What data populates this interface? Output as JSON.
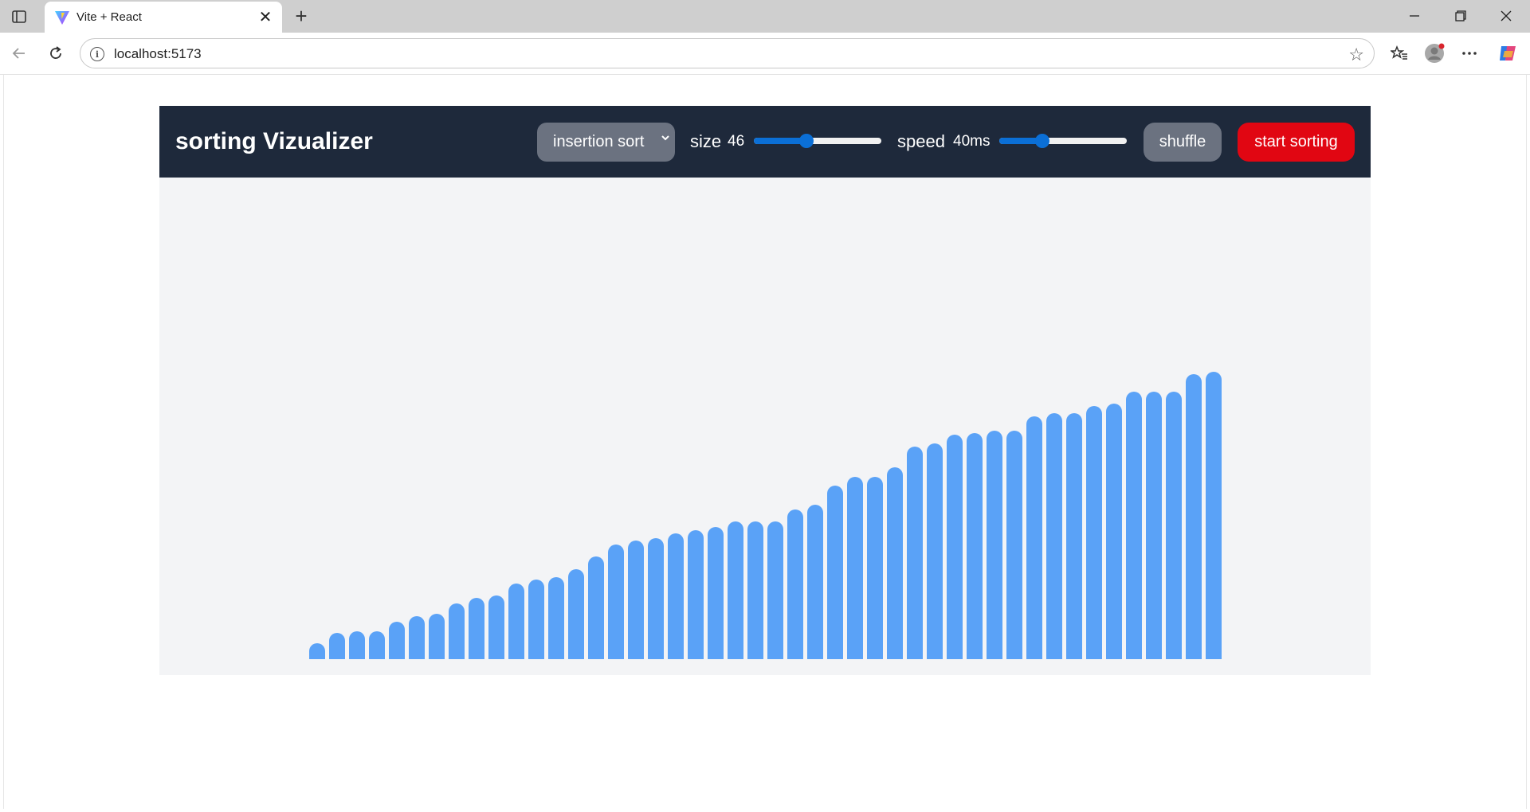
{
  "browser": {
    "tab_title": "Vite + React",
    "url": "localhost:5173",
    "new_tab_glyph": "+",
    "close_glyph": "✕"
  },
  "app": {
    "title": "sorting Vizualizer",
    "algorithm": {
      "selected": "insertion sort"
    },
    "size": {
      "label": "size",
      "value": "46",
      "min": 5,
      "max": 100,
      "fraction": 0.41
    },
    "speed": {
      "label": "speed",
      "value": "40ms",
      "fraction": 0.34
    },
    "shuffle_label": "shuffle",
    "start_label": "start sorting",
    "colors": {
      "nav": "#1e293b",
      "bar": "#5aa2f7",
      "start": "#e10612",
      "control": "#6b7280",
      "stage": "#f3f4f6"
    }
  },
  "chart_data": {
    "type": "bar",
    "values": [
      20,
      33,
      35,
      35,
      47,
      54,
      57,
      70,
      77,
      80,
      95,
      100,
      103,
      113,
      129,
      144,
      149,
      152,
      158,
      162,
      166,
      173,
      173,
      173,
      188,
      194,
      218,
      229,
      229,
      241,
      267,
      271,
      282,
      284,
      287,
      287,
      305,
      309,
      309,
      318,
      321,
      336,
      336,
      336,
      358,
      361
    ],
    "ylim": [
      0,
      600
    ]
  }
}
